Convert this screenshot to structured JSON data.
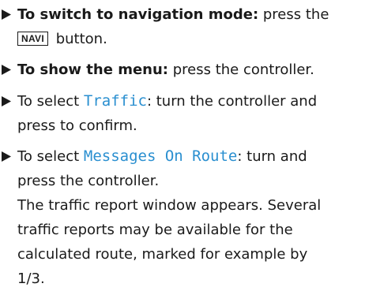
{
  "steps": [
    {
      "bold": "To switch to navigation mode:",
      "text": " press the",
      "key": "NAVI",
      "text2": " button."
    },
    {
      "bold": "To show the menu:",
      "text": " press the controller."
    },
    {
      "prefix": "To select ",
      "ui": "Traffic",
      "suffix": ": turn the controller and",
      "cont": "press to confirm."
    },
    {
      "prefix": "To select ",
      "ui": "Messages On Route",
      "suffix": ": turn and",
      "cont": "press the controller.",
      "result_lines": [
        "The traffic report window appears. Several",
        "traffic reports may be available for the",
        "calculated route, marked for example by",
        "1/3."
      ]
    }
  ]
}
